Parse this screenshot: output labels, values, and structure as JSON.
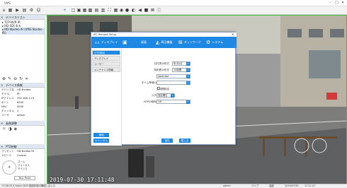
{
  "window": {
    "title": "VMS"
  },
  "toolbar": {
    "tab_label": "ライブ"
  },
  "sidebar": {
    "device_list_header": "デバイスリスト",
    "tree": [
      "TCP-NVR IR",
      "HD-SDI 4ch",
      "HD-Nvideo IR (VMS Nvideo IR)"
    ],
    "device_info_header": "デバイス情報",
    "device_info_rows": [
      {
        "k": "デバイス名",
        "v": "HD-Nvideo"
      },
      {
        "k": "モデル",
        "v": "IR"
      },
      {
        "k": "IPアドレス",
        "v": "192.168.1.10"
      },
      {
        "k": "ポート",
        "v": "8000"
      },
      {
        "k": "MAC",
        "v": "0000"
      },
      {
        "k": "チャンネル",
        "v": "1"
      },
      {
        "k": "ユーザ",
        "v": "admin"
      }
    ],
    "image_adjust_header": "画像調整",
    "ptz_header": "PTZ制御",
    "ptz_rows": [
      {
        "k": "プリセット",
        "v": "HD-Nvideo IR"
      },
      {
        "k": "スピード",
        "v": "Control"
      }
    ],
    "ptz_labels": [
      "ズーム",
      "フォーカス",
      "アイリス"
    ],
    "ptz_tour": "Tour Point"
  },
  "dialog": {
    "title": "IPC Remote Setup",
    "tabs": [
      "ディスプレイ",
      "録画",
      "周辺機器",
      "ネットワーク",
      "システム"
    ],
    "nav": [
      "日付/時刻",
      "ディスプレイ",
      "ユーザー",
      "メンテナンス情報"
    ],
    "nav_selected": 0,
    "fields": [
      {
        "label": "日付表示形式",
        "value": "年/月/日"
      },
      {
        "label": "時刻表示形式",
        "value": "24時間"
      },
      {
        "label": "言語",
        "value": "Japanese"
      },
      {
        "label": "タイム帯域の時間帯設定",
        "value": ""
      },
      {
        "label": "夏時間設定",
        "value": ""
      },
      {
        "label": "スタートモード",
        "value": "指定曜日"
      },
      {
        "label": "NTPの時刻同期の補正",
        "value": "Off"
      }
    ],
    "left_buttons": [
      "適用",
      "キャンセル"
    ],
    "apply_label": "保存",
    "cancel_label": "閉じる"
  },
  "video": {
    "osd_timestamp": "2019-07-30 17:11:48"
  },
  "statusbar": {
    "left": "17:08:33.3 Alarm DVR 接続状態の確認しました",
    "user": "admin",
    "mode": "ライブ",
    "disk": "温度",
    "date": "2019/07/30",
    "time": "17:11:47"
  },
  "colors": {
    "accent": "#1e88e5"
  }
}
